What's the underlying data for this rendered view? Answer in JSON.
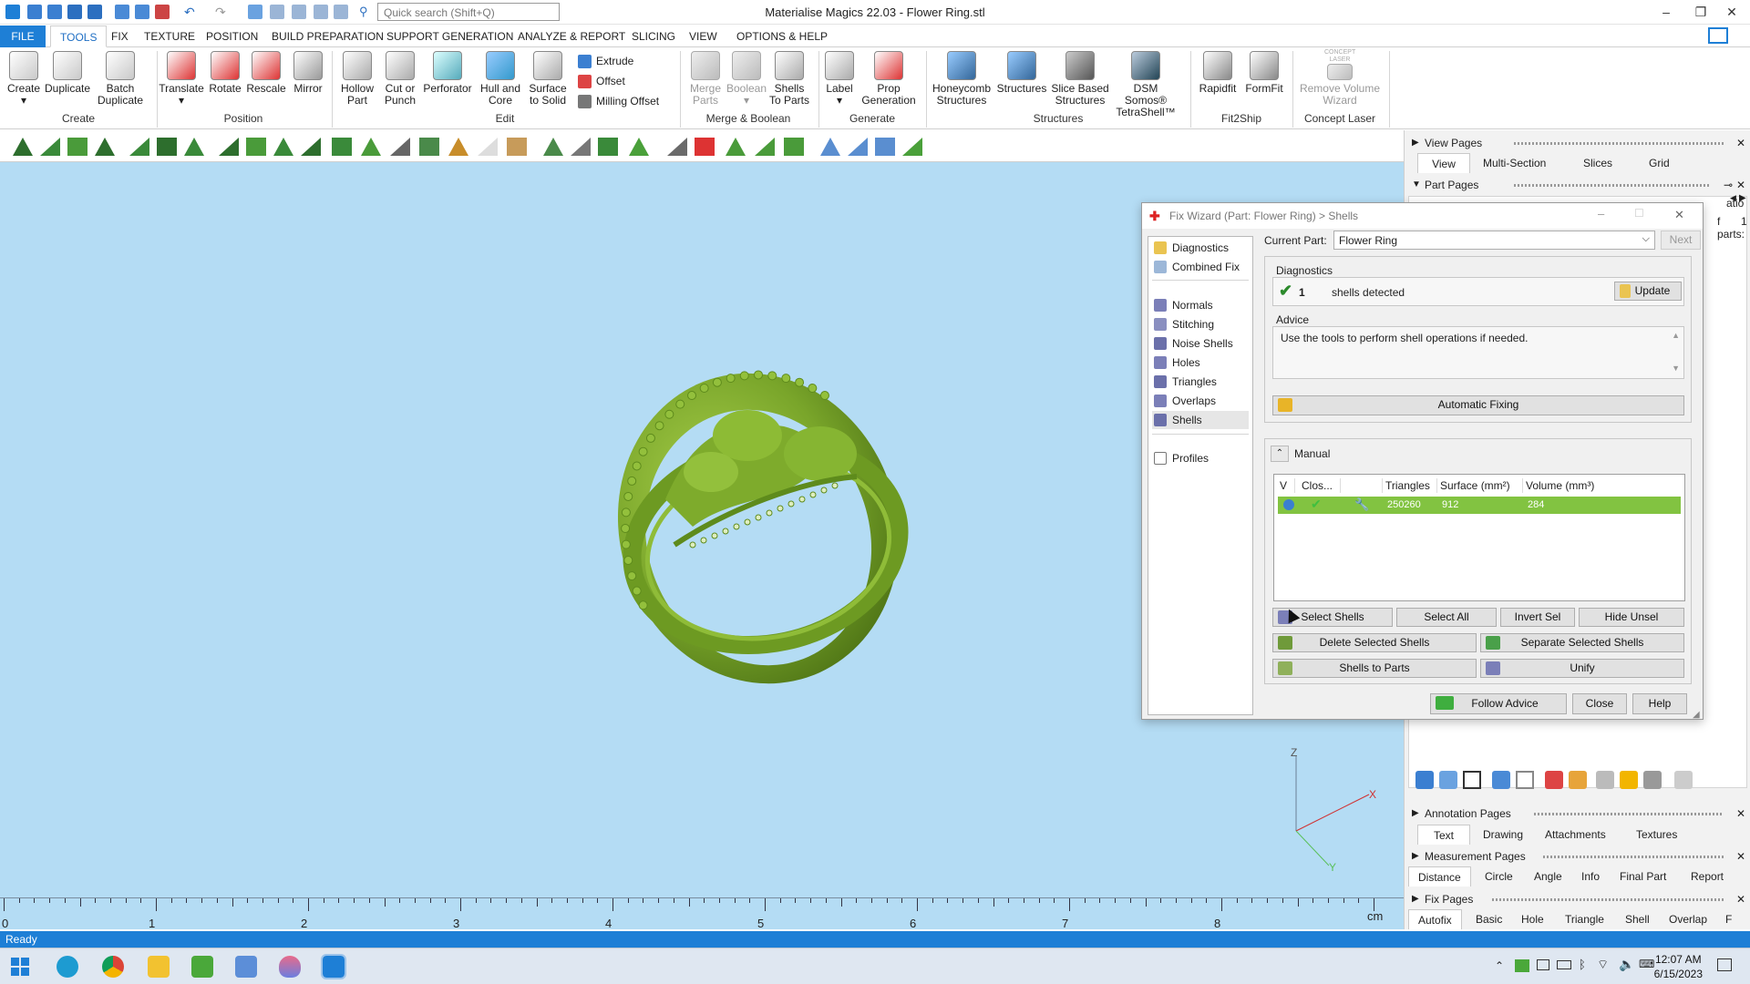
{
  "window": {
    "title": "Materialise Magics 22.03 - Flower Ring.stl",
    "search_placeholder": "Quick search (Shift+Q)",
    "minimize": "–",
    "maximize": "❐",
    "close": "✕"
  },
  "menu": {
    "tabs": [
      "FILE",
      "TOOLS",
      "FIX",
      "TEXTURE",
      "POSITION",
      "BUILD PREPARATION",
      "SUPPORT GENERATION",
      "ANALYZE & REPORT",
      "SLICING",
      "VIEW",
      "OPTIONS & HELP"
    ],
    "active": "TOOLS"
  },
  "ribbon": {
    "create": "Create",
    "duplicate": "Duplicate",
    "batch_duplicate": "Batch Duplicate",
    "group_create": "Create",
    "translate": "Translate",
    "rotate": "Rotate",
    "rescale": "Rescale",
    "mirror": "Mirror",
    "group_position": "Position",
    "hollow_part": "Hollow Part",
    "cut_or_punch": "Cut or Punch",
    "perforator": "Perforator",
    "hull_and_core": "Hull and Core",
    "surface_to_solid": "Surface to Solid",
    "extrude": "Extrude",
    "offset": "Offset",
    "milling_offset": "Milling Offset",
    "group_edit": "Edit",
    "merge_parts": "Merge Parts",
    "boolean": "Boolean",
    "shells_to_parts": "Shells To Parts",
    "group_merge": "Merge & Boolean",
    "label": "Label",
    "prop_generation": "Prop Generation",
    "group_generate": "Generate",
    "honeycomb_structures": "Honeycomb Structures",
    "structures": "Structures",
    "slice_based_structures": "Slice Based Structures",
    "dsm_somos": "DSM Somos® TetraShell™",
    "group_structures": "Structures",
    "rapidfit": "Rapidfit",
    "formfit": "FormFit",
    "group_fit2ship": "Fit2Ship",
    "remove_volume_wizard": "Remove Volume Wizard",
    "concept_laser_badge": "CONCEPT LASER",
    "group_concept_laser": "Concept Laser"
  },
  "viewport": {
    "ruler_labels": [
      "0",
      "1",
      "2",
      "3",
      "4",
      "5",
      "6",
      "7",
      "8"
    ],
    "ruler_unit": "cm",
    "axis_z": "Z",
    "axis_x": "X",
    "axis_y": "Y"
  },
  "status": {
    "text": "Ready"
  },
  "taskbar": {
    "time": "12:07 AM",
    "date": "6/15/2023"
  },
  "right_panel": {
    "view_pages": "View Pages",
    "view_tabs": [
      "View",
      "Multi-Section",
      "Slices",
      "Grid"
    ],
    "part_pages": "Part Pages",
    "part_fragment_1": "atio",
    "part_fragment_2": "f parts:",
    "part_count": "1",
    "annotation_pages": "Annotation Pages",
    "annotation_tabs": [
      "Text",
      "Drawing",
      "Attachments",
      "Textures"
    ],
    "measurement_pages": "Measurement Pages",
    "measurement_tabs": [
      "Distance",
      "Circle",
      "Angle",
      "Info",
      "Final Part",
      "Report"
    ],
    "fix_pages": "Fix Pages",
    "fix_tabs": [
      "Autofix",
      "Basic",
      "Hole",
      "Triangle",
      "Shell",
      "Overlap",
      "F"
    ]
  },
  "fix_wizard": {
    "title": "Fix Wizard (Part: Flower Ring) > Shells",
    "nav": [
      "Diagnostics",
      "Combined Fix",
      "Normals",
      "Stitching",
      "Noise Shells",
      "Holes",
      "Triangles",
      "Overlaps",
      "Shells",
      "Profiles"
    ],
    "nav_selected": "Shells",
    "current_part_label": "Current Part:",
    "current_part_value": "Flower Ring",
    "next": "Next",
    "diagnostics_label": "Diagnostics",
    "shell_count": "1",
    "shells_detected": "shells detected",
    "update": "Update",
    "advice_label": "Advice",
    "advice_text": "Use the tools to perform shell operations if needed.",
    "automatic_fixing": "Automatic Fixing",
    "manual_label": "Manual",
    "columns": [
      "V",
      "Clos...",
      "Triangles",
      "Surface (mm²)",
      "Volume (mm³)"
    ],
    "rows": [
      {
        "triangles": "250260",
        "surface": "912",
        "volume": "284"
      }
    ],
    "select_shells": "Select Shells",
    "select_all": "Select All",
    "invert_sel": "Invert Sel",
    "hide_unsel": "Hide Unsel",
    "delete_selected_shells": "Delete Selected Shells",
    "separate_selected_shells": "Separate Selected Shells",
    "shells_to_parts": "Shells to Parts",
    "unify": "Unify",
    "follow_advice": "Follow Advice",
    "close": "Close",
    "help": "Help"
  },
  "colors": {
    "accent": "#1e7fd6",
    "viewport_bg": "#b4dcf4",
    "part_green": "#7aa82a",
    "row_green": "#82c341"
  }
}
